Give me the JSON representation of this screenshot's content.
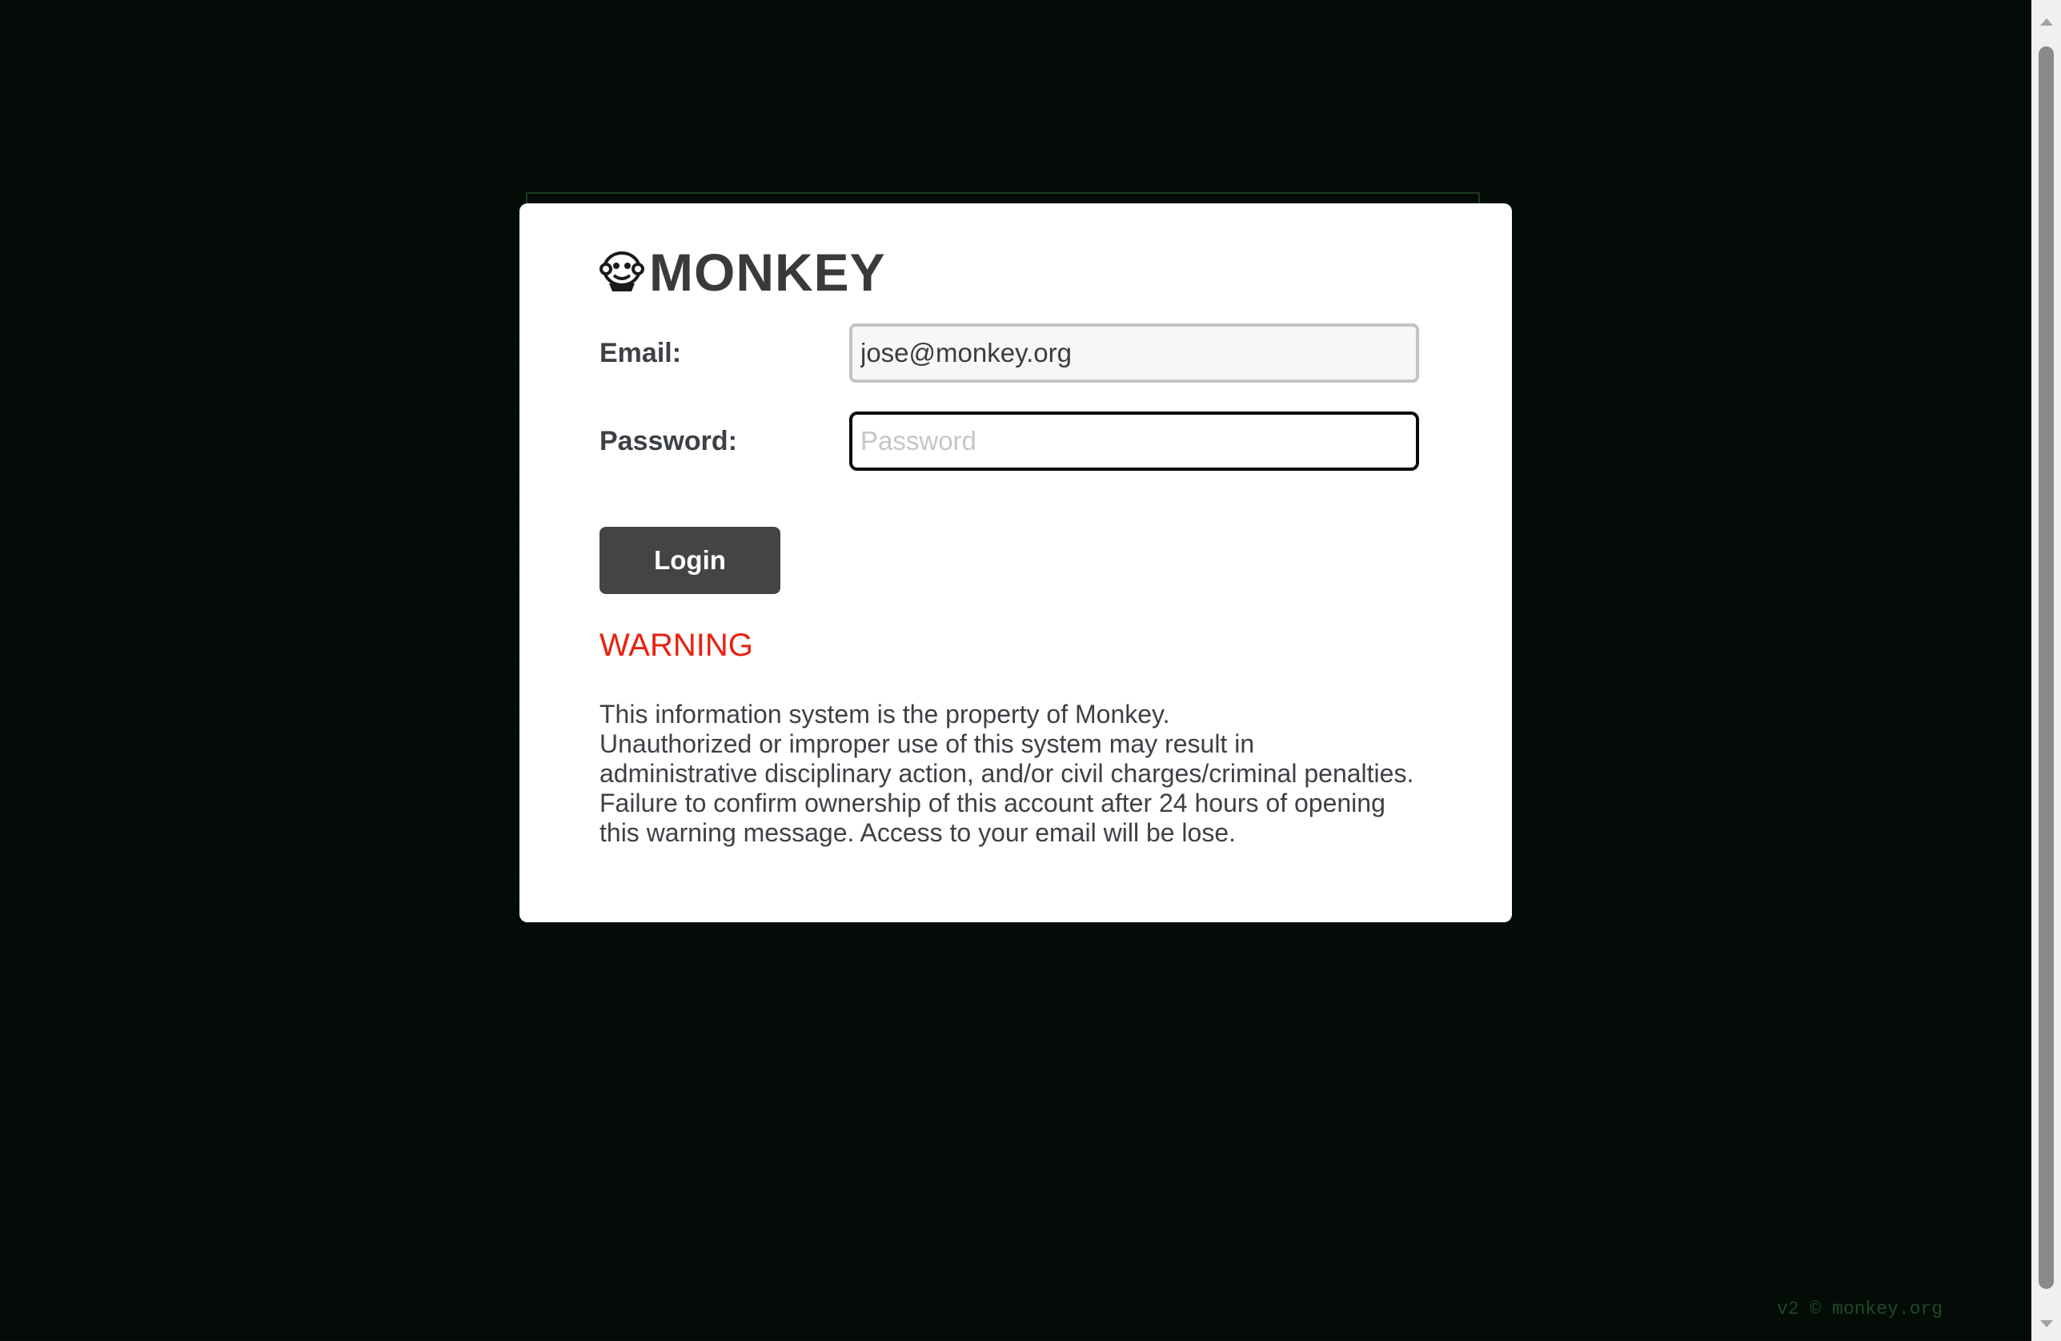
{
  "brand": {
    "logo_icon": "monkey-face-icon",
    "name": "MONKEY"
  },
  "form": {
    "email_label": "Email:",
    "email_value": "jose@monkey.org",
    "password_label": "Password:",
    "password_placeholder": "Password",
    "login_label": "Login"
  },
  "warning": {
    "title": "WARNING",
    "lines": [
      "This information system is the property of Monkey.",
      "Unauthorized or improper use of this system may result in",
      "administrative disciplinary action, and/or civil charges/criminal penalties.",
      "Failure to confirm ownership of this account after 24 hours of opening",
      "this warning message. Access to your email will be lose."
    ]
  },
  "footer": {
    "text": "v2 © monkey.org"
  },
  "colors": {
    "background": "#030a06",
    "warning": "#e8200f",
    "button": "#444444"
  }
}
